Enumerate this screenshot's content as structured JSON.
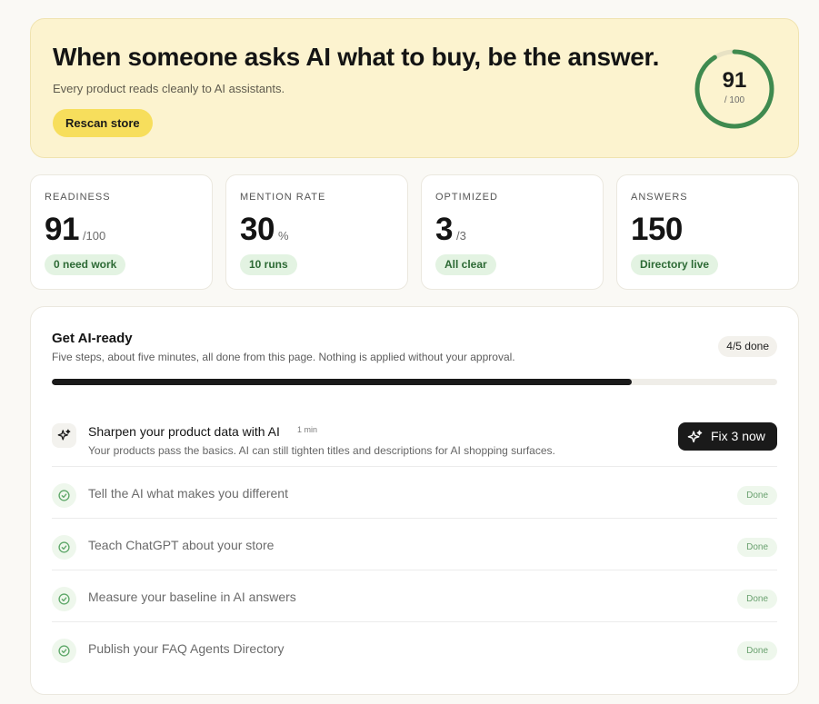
{
  "hero": {
    "title": "When someone asks AI what to buy, be the answer.",
    "subtitle": "Every product reads cleanly to AI assistants.",
    "rescan_label": "Rescan store",
    "score": "91",
    "score_max": "/ 100",
    "score_fraction": 0.91,
    "ring_color": "#3f8a4f"
  },
  "stats": [
    {
      "label": "READINESS",
      "value": "91",
      "unit": "/100",
      "badge": "0 need work"
    },
    {
      "label": "MENTION RATE",
      "value": "30",
      "unit": "%",
      "badge": "10 runs"
    },
    {
      "label": "OPTIMIZED",
      "value": "3",
      "unit": "/3",
      "badge": "All clear"
    },
    {
      "label": "ANSWERS",
      "value": "150",
      "unit": "",
      "badge": "Directory live"
    }
  ],
  "steps": {
    "title": "Get AI-ready",
    "subtitle": "Five steps, about five minutes, all done from this page. Nothing is applied without your approval.",
    "done_count": "4/5 done",
    "progress_fraction": 0.8,
    "active": {
      "title": "Sharpen your product data with AI",
      "eta": "1 min",
      "description": "Your products pass the basics. AI can still tighten titles and descriptions for AI shopping surfaces.",
      "action_label": "Fix 3 now"
    },
    "done": [
      {
        "title": "Tell the AI what makes you different",
        "status": "Done"
      },
      {
        "title": "Teach ChatGPT about your store",
        "status": "Done"
      },
      {
        "title": "Measure your baseline in AI answers",
        "status": "Done"
      },
      {
        "title": "Publish your FAQ Agents Directory",
        "status": "Done"
      }
    ]
  }
}
